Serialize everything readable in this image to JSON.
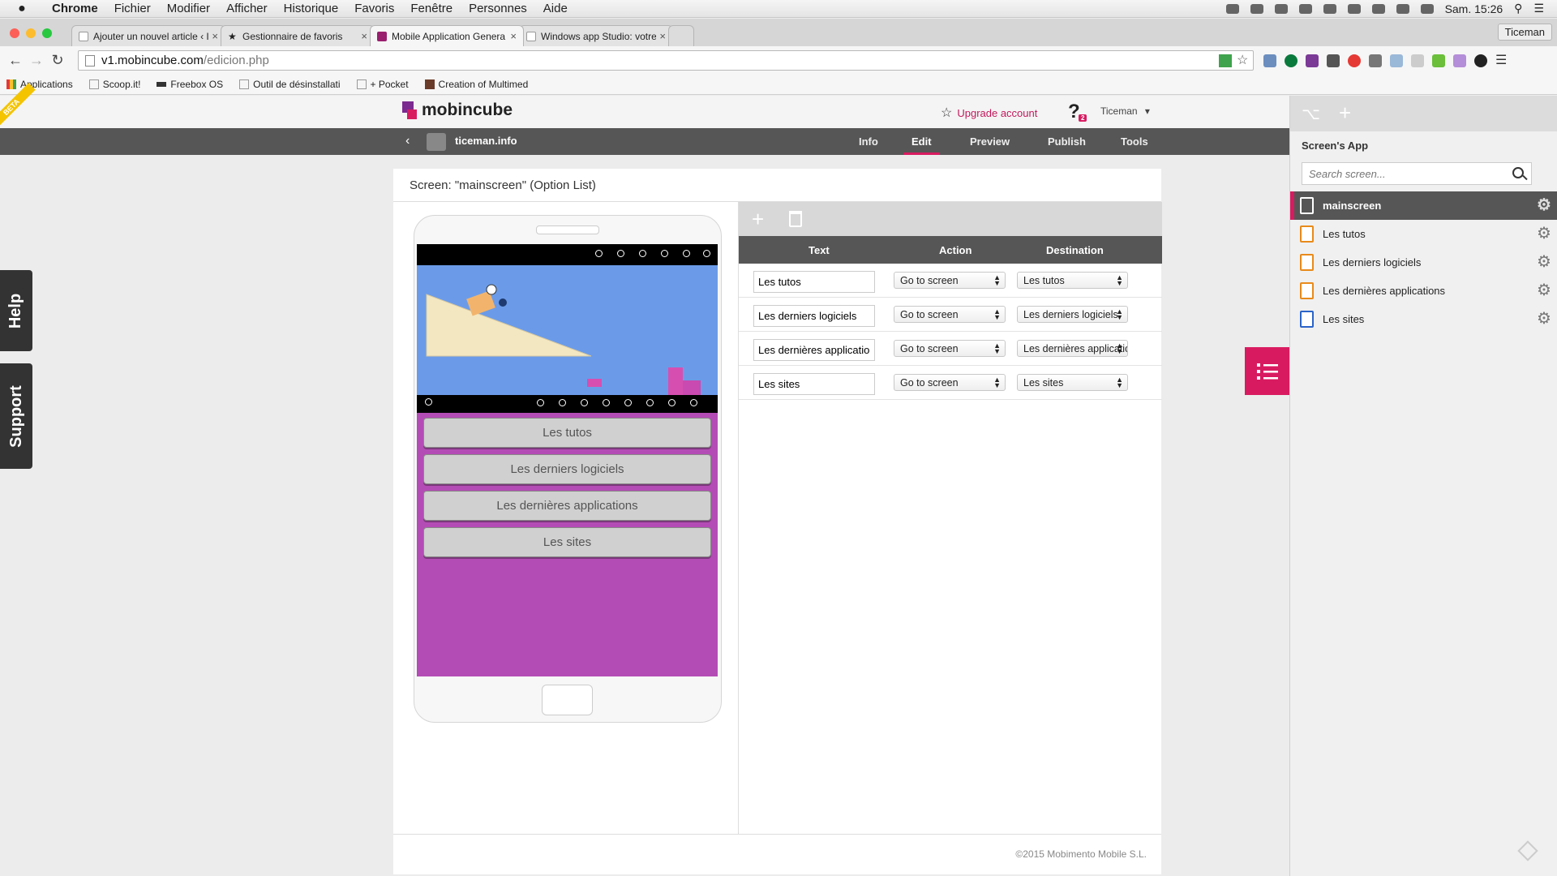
{
  "os_menubar": {
    "apple": "",
    "items": [
      "Chrome",
      "Fichier",
      "Modifier",
      "Afficher",
      "Historique",
      "Favoris",
      "Fenêtre",
      "Personnes",
      "Aide"
    ],
    "clock": "Sam. 15:26"
  },
  "browser": {
    "tabs": [
      {
        "title": "Ajouter un nouvel article ‹ I",
        "icon": "page-icon"
      },
      {
        "title": "Gestionnaire de favoris",
        "icon": "star-icon"
      },
      {
        "title": "Mobile Application Genera",
        "icon": "mobincube-icon"
      },
      {
        "title": "Windows app Studio: votre",
        "icon": "page-icon"
      }
    ],
    "profile": "Ticeman",
    "url_host": "v1.mobincube.com",
    "url_path": "/edicion.php",
    "bookmarks": [
      {
        "label": "Applications",
        "icon": "apps-grid-icon"
      },
      {
        "label": "Scoop.it!",
        "icon": "page-icon"
      },
      {
        "label": "Freebox OS",
        "icon": "freebox-icon"
      },
      {
        "label": "Outil de désinstallati",
        "icon": "page-icon"
      },
      {
        "label": "+ Pocket",
        "icon": "page-icon"
      },
      {
        "label": "Creation of Multimed",
        "icon": "image-icon"
      }
    ]
  },
  "app": {
    "logo_text": "mobincube",
    "beta_label": "BETA",
    "upgrade_label": "Upgrade account",
    "help_badge": "2",
    "username": "Ticeman",
    "app_name": "ticeman.info",
    "nav": [
      "Info",
      "Edit",
      "Preview",
      "Publish",
      "Tools"
    ],
    "active_nav": "Edit",
    "accent_color": "#d81b60"
  },
  "side_tabs": {
    "help": "Help",
    "support": "Support"
  },
  "editor": {
    "screen_title": "Screen: \"mainscreen\" (Option List)",
    "columns": [
      "Text",
      "Action",
      "Destination"
    ],
    "rows": [
      {
        "text": "Les tutos",
        "action": "Go to screen",
        "destination": "Les tutos"
      },
      {
        "text": "Les derniers logiciels",
        "action": "Go to screen",
        "destination": "Les derniers logiciels"
      },
      {
        "text": "Les dernières applications",
        "action": "Go to screen",
        "destination": "Les dernières applications"
      },
      {
        "text": "Les sites",
        "action": "Go to screen",
        "destination": "Les sites"
      }
    ],
    "footer": "©2015 Mobimento Mobile S.L."
  },
  "phone_preview": {
    "buttons": [
      "Les tutos",
      "Les derniers logiciels",
      "Les dernières applications",
      "Les sites"
    ],
    "background_color": "#b44cb5"
  },
  "right_panel": {
    "title": "Screen's App",
    "search_placeholder": "Search screen...",
    "screens": [
      {
        "label": "mainscreen",
        "active": true,
        "icon": "list-screen-icon"
      },
      {
        "label": "Les tutos",
        "active": false,
        "icon": "rss-screen-icon"
      },
      {
        "label": "Les derniers logiciels",
        "active": false,
        "icon": "rss-screen-icon"
      },
      {
        "label": "Les dernières applications",
        "active": false,
        "icon": "rss-screen-icon"
      },
      {
        "label": "Les sites",
        "active": false,
        "icon": "list-screen-icon"
      }
    ]
  }
}
